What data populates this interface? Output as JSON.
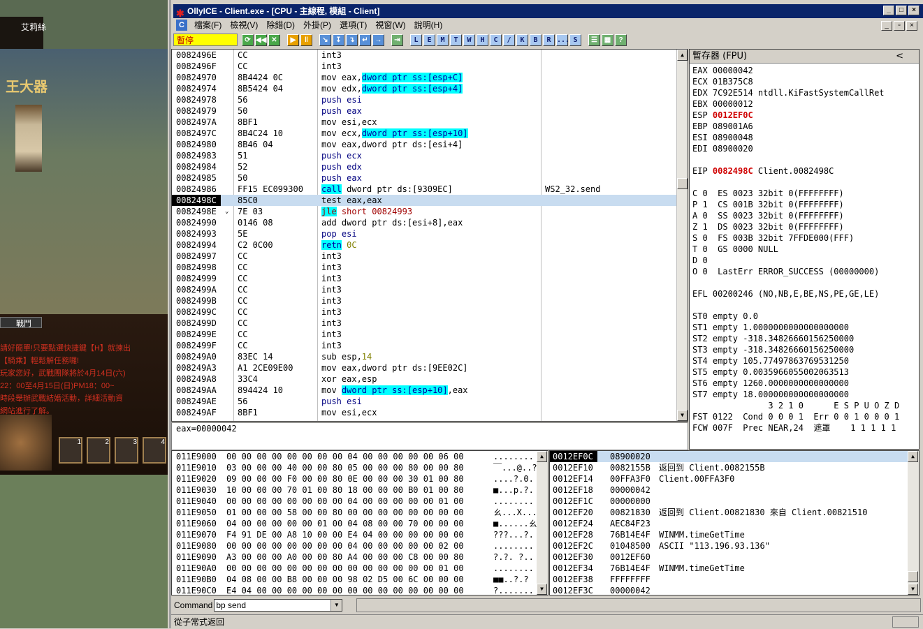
{
  "game": {
    "player_name": "艾莉絲",
    "npc_title": "王大器",
    "battle_button": "戰鬥",
    "chat_lines": [
      "請好簡單!只要點選快捷鍵【H】就揀出",
      "【騎乘】輕鬆解任務囉!",
      "玩家您好，武戰團隊將於4月14日(六)",
      "22：00至4月15日(日)PM18：00~",
      "時段舉辦武戰結婚活動，詳細活動資",
      "網站進行了解。"
    ],
    "skill_numbers": [
      "1",
      "2",
      "3",
      "4"
    ]
  },
  "window": {
    "title": "OllyICE - Client.exe - [CPU - 主線程, 模組 - Client]",
    "logo": "✱",
    "min": "_",
    "max": "□",
    "close": "×"
  },
  "menu": {
    "icon": "C",
    "items": [
      "檔案(F)",
      "檢視(V)",
      "除錯(D)",
      "外掛(P)",
      "選項(T)",
      "視窗(W)",
      "說明(H)"
    ]
  },
  "toolbar": {
    "state": "暫停",
    "buttons": [
      {
        "l": "⟳",
        "c": "g"
      },
      {
        "l": "◀◀",
        "c": "g"
      },
      {
        "l": "✕",
        "c": "g"
      },
      {
        "l": "",
        "c": "sep"
      },
      {
        "l": "▶",
        "c": "o"
      },
      {
        "l": "‖",
        "c": "o"
      },
      {
        "l": "",
        "c": "sep"
      },
      {
        "l": "↘",
        "c": "b"
      },
      {
        "l": "↧",
        "c": "b"
      },
      {
        "l": "↴",
        "c": "b"
      },
      {
        "l": "↵",
        "c": "b"
      },
      {
        "l": "→",
        "c": "b"
      },
      {
        "l": "",
        "c": "sep"
      },
      {
        "l": "⇥",
        "c": "gr"
      },
      {
        "l": "",
        "c": "sep"
      },
      {
        "l": "L",
        "c": "l"
      },
      {
        "l": "E",
        "c": "l"
      },
      {
        "l": "M",
        "c": "l"
      },
      {
        "l": "T",
        "c": "l"
      },
      {
        "l": "W",
        "c": "l"
      },
      {
        "l": "H",
        "c": "l"
      },
      {
        "l": "C",
        "c": "l"
      },
      {
        "l": "/",
        "c": "l"
      },
      {
        "l": "K",
        "c": "l"
      },
      {
        "l": "B",
        "c": "l"
      },
      {
        "l": "R",
        "c": "l"
      },
      {
        "l": "...",
        "c": "l"
      },
      {
        "l": "S",
        "c": "l"
      },
      {
        "l": "",
        "c": "sep"
      },
      {
        "l": "☰",
        "c": "gr"
      },
      {
        "l": "▦",
        "c": "gr"
      },
      {
        "l": "?",
        "c": "gr"
      }
    ]
  },
  "disasm": [
    {
      "a": "0082496E",
      "h": "CC",
      "d": [
        [
          "int3",
          ""
        ]
      ],
      "c": ""
    },
    {
      "a": "0082496F",
      "h": "CC",
      "d": [
        [
          "int3",
          ""
        ]
      ],
      "c": ""
    },
    {
      "a": "00824970",
      "h": "8B4424 0C",
      "d": [
        [
          "mov eax,",
          ""
        ],
        [
          "dword ptr ss:[esp+C]",
          "cy"
        ]
      ],
      "c": ""
    },
    {
      "a": "00824974",
      "h": "8B5424 04",
      "d": [
        [
          "mov edx,",
          ""
        ],
        [
          "dword ptr ss:[esp+4]",
          "cy"
        ]
      ],
      "c": ""
    },
    {
      "a": "00824978",
      "h": "56",
      "d": [
        [
          "push esi",
          "kw"
        ]
      ],
      "c": ""
    },
    {
      "a": "00824979",
      "h": "50",
      "d": [
        [
          "push eax",
          "kw"
        ]
      ],
      "c": ""
    },
    {
      "a": "0082497A",
      "h": "8BF1",
      "d": [
        [
          "mov esi,ecx",
          ""
        ]
      ],
      "c": ""
    },
    {
      "a": "0082497C",
      "h": "8B4C24 10",
      "d": [
        [
          "mov ecx,",
          ""
        ],
        [
          "dword ptr ss:[esp+10]",
          "cy"
        ]
      ],
      "c": ""
    },
    {
      "a": "00824980",
      "h": "8B46 04",
      "d": [
        [
          "mov eax,dword ptr ds:[esi+4]",
          ""
        ]
      ],
      "c": ""
    },
    {
      "a": "00824983",
      "h": "51",
      "d": [
        [
          "push ecx",
          "kw"
        ]
      ],
      "c": ""
    },
    {
      "a": "00824984",
      "h": "52",
      "d": [
        [
          "push edx",
          "kw"
        ]
      ],
      "c": ""
    },
    {
      "a": "00824985",
      "h": "50",
      "d": [
        [
          "push eax",
          "kw"
        ]
      ],
      "c": ""
    },
    {
      "a": "00824986",
      "h": "FF15 EC099300",
      "d": [
        [
          "call",
          "cy"
        ],
        [
          " dword ptr ds:[9309EC]",
          ""
        ]
      ],
      "c": "WS2_32.send"
    },
    {
      "a": "0082498C",
      "h": "85C0",
      "d": [
        [
          "test eax,eax",
          ""
        ]
      ],
      "c": "",
      "sel": true
    },
    {
      "a": "0082498E",
      "h": "7E 03",
      "d": [
        [
          "jle",
          "cyred"
        ],
        [
          " short 00824993",
          "red"
        ]
      ],
      "c": "",
      "j": "⌄"
    },
    {
      "a": "00824990",
      "h": "0146 08",
      "d": [
        [
          "add dword ptr ds:[esi+8],eax",
          ""
        ]
      ],
      "c": ""
    },
    {
      "a": "00824993",
      "h": "5E",
      "d": [
        [
          "pop esi",
          "kw"
        ]
      ],
      "c": ""
    },
    {
      "a": "00824994",
      "h": "C2 0C00",
      "d": [
        [
          "retn",
          "cy"
        ],
        [
          " 0C",
          "ol"
        ]
      ],
      "c": ""
    },
    {
      "a": "00824997",
      "h": "CC",
      "d": [
        [
          "int3",
          ""
        ]
      ],
      "c": ""
    },
    {
      "a": "00824998",
      "h": "CC",
      "d": [
        [
          "int3",
          ""
        ]
      ],
      "c": ""
    },
    {
      "a": "00824999",
      "h": "CC",
      "d": [
        [
          "int3",
          ""
        ]
      ],
      "c": ""
    },
    {
      "a": "0082499A",
      "h": "CC",
      "d": [
        [
          "int3",
          ""
        ]
      ],
      "c": ""
    },
    {
      "a": "0082499B",
      "h": "CC",
      "d": [
        [
          "int3",
          ""
        ]
      ],
      "c": ""
    },
    {
      "a": "0082499C",
      "h": "CC",
      "d": [
        [
          "int3",
          ""
        ]
      ],
      "c": ""
    },
    {
      "a": "0082499D",
      "h": "CC",
      "d": [
        [
          "int3",
          ""
        ]
      ],
      "c": ""
    },
    {
      "a": "0082499E",
      "h": "CC",
      "d": [
        [
          "int3",
          ""
        ]
      ],
      "c": ""
    },
    {
      "a": "0082499F",
      "h": "CC",
      "d": [
        [
          "int3",
          ""
        ]
      ],
      "c": ""
    },
    {
      "a": "008249A0",
      "h": "83EC 14",
      "d": [
        [
          "sub esp,",
          ""
        ],
        [
          "14",
          "ol"
        ]
      ],
      "c": ""
    },
    {
      "a": "008249A3",
      "h": "A1 2CE09E00",
      "d": [
        [
          "mov eax,dword ptr ds:[9EE02C]",
          ""
        ]
      ],
      "c": ""
    },
    {
      "a": "008249A8",
      "h": "33C4",
      "d": [
        [
          "xor eax,esp",
          ""
        ]
      ],
      "c": ""
    },
    {
      "a": "008249AA",
      "h": "894424 10",
      "d": [
        [
          "mov ",
          ""
        ],
        [
          "dword ptr ss:[esp+10]",
          "cy"
        ],
        [
          ",eax",
          ""
        ]
      ],
      "c": ""
    },
    {
      "a": "008249AE",
      "h": "56",
      "d": [
        [
          "push esi",
          "kw"
        ]
      ],
      "c": ""
    },
    {
      "a": "008249AF",
      "h": "8BF1",
      "d": [
        [
          "mov esi,ecx",
          ""
        ]
      ],
      "c": ""
    }
  ],
  "info_line": "eax=00000042",
  "registers": {
    "header": "暫存器 (FPU)",
    "chevron": "<",
    "lines": [
      [
        [
          "EAX 00000042",
          ""
        ]
      ],
      [
        [
          "ECX 01B375C8",
          ""
        ]
      ],
      [
        [
          "EDX 7C92E514 ntdll.KiFastSystemCallRet",
          ""
        ]
      ],
      [
        [
          "EBX 00000012",
          ""
        ]
      ],
      [
        [
          "ESP ",
          ""
        ],
        [
          "0012EF0C",
          "red"
        ]
      ],
      [
        [
          "EBP 089001A6",
          ""
        ]
      ],
      [
        [
          "ESI 08900048",
          ""
        ]
      ],
      [
        [
          "EDI 08900020",
          ""
        ]
      ],
      [
        [
          "",
          ""
        ]
      ],
      [
        [
          "EIP ",
          ""
        ],
        [
          "0082498C",
          "red"
        ],
        [
          " Client.0082498C",
          ""
        ]
      ],
      [
        [
          "",
          ""
        ]
      ],
      [
        [
          "C 0  ES 0023 32bit 0(FFFFFFFF)",
          ""
        ]
      ],
      [
        [
          "P 1  CS 001B 32bit 0(FFFFFFFF)",
          ""
        ]
      ],
      [
        [
          "A 0  SS 0023 32bit 0(FFFFFFFF)",
          ""
        ]
      ],
      [
        [
          "Z 1  DS 0023 32bit 0(FFFFFFFF)",
          ""
        ]
      ],
      [
        [
          "S 0  FS 003B 32bit 7FFDE000(FFF)",
          ""
        ]
      ],
      [
        [
          "T 0  GS 0000 NULL",
          ""
        ]
      ],
      [
        [
          "D 0",
          ""
        ]
      ],
      [
        [
          "O 0  LastErr ERROR_SUCCESS (00000000)",
          ""
        ]
      ],
      [
        [
          "",
          ""
        ]
      ],
      [
        [
          "EFL 00200246 (NO,NB,E,BE,NS,PE,GE,LE)",
          ""
        ]
      ],
      [
        [
          "",
          ""
        ]
      ],
      [
        [
          "ST0 empty 0.0",
          ""
        ]
      ],
      [
        [
          "ST1 empty 1.0000000000000000000",
          ""
        ]
      ],
      [
        [
          "ST2 empty -318.34826660156250000",
          ""
        ]
      ],
      [
        [
          "ST3 empty -318.34826660156250000",
          ""
        ]
      ],
      [
        [
          "ST4 empty 105.77497863769531250",
          ""
        ]
      ],
      [
        [
          "ST5 empty 0.0035966055002063513",
          ""
        ]
      ],
      [
        [
          "ST6 empty 1260.0000000000000000",
          ""
        ]
      ],
      [
        [
          "ST7 empty 18.000000000000000000",
          ""
        ]
      ],
      [
        [
          "               3 2 1 0      E S P U O Z D",
          ""
        ]
      ],
      [
        [
          "FST 0122  Cond 0 0 0 1  Err 0 0 1 0 0 0 1",
          ""
        ]
      ],
      [
        [
          "FCW 007F  Prec NEAR,24  遮罩    1 1 1 1 1",
          ""
        ]
      ]
    ]
  },
  "dump": [
    {
      "a": "011E9000",
      "x": "00 00 00 00 00 00 00 00 04 00 00 00 00 00 06 00",
      "s": "........"
    },
    {
      "a": "011E9010",
      "x": "03 00 00 00 40 00 00 80 05 00 00 00 80 00 00 80",
      "s": "￣...@..?"
    },
    {
      "a": "011E9020",
      "x": "09 00 00 00 F0 00 00 80 0E 00 00 00 30 01 00 80",
      "s": "....?.0."
    },
    {
      "a": "011E9030",
      "x": "10 00 00 00 70 01 00 80 18 00 00 00 B0 01 00 80",
      "s": "■...p.?."
    },
    {
      "a": "011E9040",
      "x": "00 00 00 00 00 00 00 00 04 00 00 00 00 00 01 00",
      "s": "........"
    },
    {
      "a": "011E9050",
      "x": "01 00 00 00 58 00 00 80 00 00 00 00 00 00 00 00",
      "s": "ㄠ...X..."
    },
    {
      "a": "011E9060",
      "x": "04 00 00 00 00 00 01 00 04 08 00 00 70 00 00 00",
      "s": "■......ㄠ"
    },
    {
      "a": "011E9070",
      "x": "F4 91 DE 00 A8 10 00 00 E4 04 00 00 00 00 00 00",
      "s": "???...?."
    },
    {
      "a": "011E9080",
      "x": "00 00 00 00 00 00 00 00 04 00 00 00 00 00 02 00",
      "s": "........"
    },
    {
      "a": "011E9090",
      "x": "A3 00 00 00 A0 00 00 80 A4 00 00 00 C8 00 00 80",
      "s": "?.?. ?.."
    },
    {
      "a": "011E90A0",
      "x": "00 00 00 00 00 00 00 00 00 00 00 00 00 00 01 00",
      "s": "........"
    },
    {
      "a": "011E90B0",
      "x": "04 08 00 00 B8 00 00 00 98 02 D5 00 6C 00 00 00",
      "s": "■■..?.?"
    },
    {
      "a": "011E90C0",
      "x": "E4 04 00 00 00 00 00 00 00 00 00 00 00 00 00 00",
      "s": "?......."
    }
  ],
  "stack": [
    {
      "a": "0012EF0C",
      "v": "08900020",
      "c": "",
      "sel": true
    },
    {
      "a": "0012EF10",
      "v": "0082155B",
      "c": "返回到 Client.0082155B"
    },
    {
      "a": "0012EF14",
      "v": "00FFA3F0",
      "c": "Client.00FFA3F0"
    },
    {
      "a": "0012EF18",
      "v": "00000042",
      "c": ""
    },
    {
      "a": "0012EF1C",
      "v": "00000000",
      "c": ""
    },
    {
      "a": "0012EF20",
      "v": "00821830",
      "c": "返回到 Client.00821830 來自 Client.00821510"
    },
    {
      "a": "0012EF24",
      "v": "AEC84F23",
      "c": ""
    },
    {
      "a": "0012EF28",
      "v": "76B14E4F",
      "c": "WINMM.timeGetTime"
    },
    {
      "a": "0012EF2C",
      "v": "01048500",
      "c": "ASCII \"113.196.93.136\""
    },
    {
      "a": "0012EF30",
      "v": "0012EF60",
      "c": ""
    },
    {
      "a": "0012EF34",
      "v": "76B14E4F",
      "c": "WINMM.timeGetTime"
    },
    {
      "a": "0012EF38",
      "v": "FFFFFFFF",
      "c": ""
    },
    {
      "a": "0012EF3C",
      "v": "00000042",
      "c": ""
    }
  ],
  "command": {
    "label": "Command",
    "value": "bp send"
  },
  "status": "從子常式返回"
}
